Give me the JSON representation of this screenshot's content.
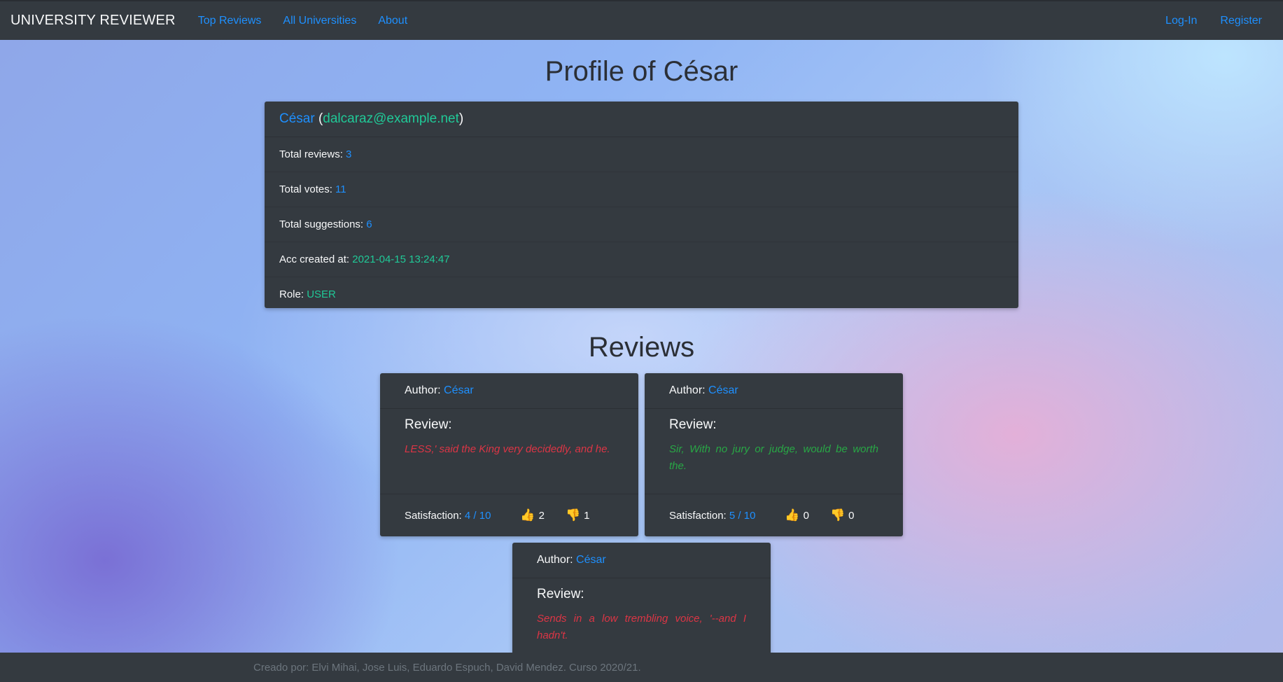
{
  "nav": {
    "brand": "UNIVERSITY REVIEWER",
    "links": [
      "Top Reviews",
      "All Universities",
      "About"
    ],
    "right_links": [
      "Log-In",
      "Register"
    ]
  },
  "profile": {
    "title": "Profile of César",
    "name": "César",
    "email": "dalcaraz@example.net",
    "rows": [
      {
        "label": "Total reviews:",
        "value": "3"
      },
      {
        "label": "Total votes:",
        "value": "11"
      },
      {
        "label": "Total suggestions:",
        "value": "6"
      },
      {
        "label": "Acc created at:",
        "value": "2021-04-15 13:24:47"
      },
      {
        "label": "Role:",
        "value": "USER"
      }
    ]
  },
  "reviews_title": "Reviews",
  "reviews": [
    {
      "author_label": "Author:",
      "author": "César",
      "review_label": "Review:",
      "text": "LESS,' said the King very decidedly, and he.",
      "satisfaction_label": "Satisfaction:",
      "satisfaction": "4 / 10",
      "up": "2",
      "down": "1"
    },
    {
      "author_label": "Author:",
      "author": "César",
      "review_label": "Review:",
      "text": "Sir, With no jury or judge, would be worth the.",
      "satisfaction_label": "Satisfaction:",
      "satisfaction": "5 / 10",
      "up": "0",
      "down": "0"
    },
    {
      "author_label": "Author:",
      "author": "César",
      "review_label": "Review:",
      "text": "Sends in a low trembling voice, '--and I hadn't."
    }
  ],
  "footer": "Creado por: Elvi Mihai, Jose Luis, Eduardo Espuch, David Mendez. Curso 2020/21.",
  "icons": {
    "upvote": "thumbs-up-icon",
    "downvote": "thumbs-down-icon"
  },
  "colors": {
    "navbar": "#343a40",
    "link": "#1e90ff",
    "teal": "#20c997",
    "negative": "#dc3545",
    "positive": "#28a745"
  }
}
